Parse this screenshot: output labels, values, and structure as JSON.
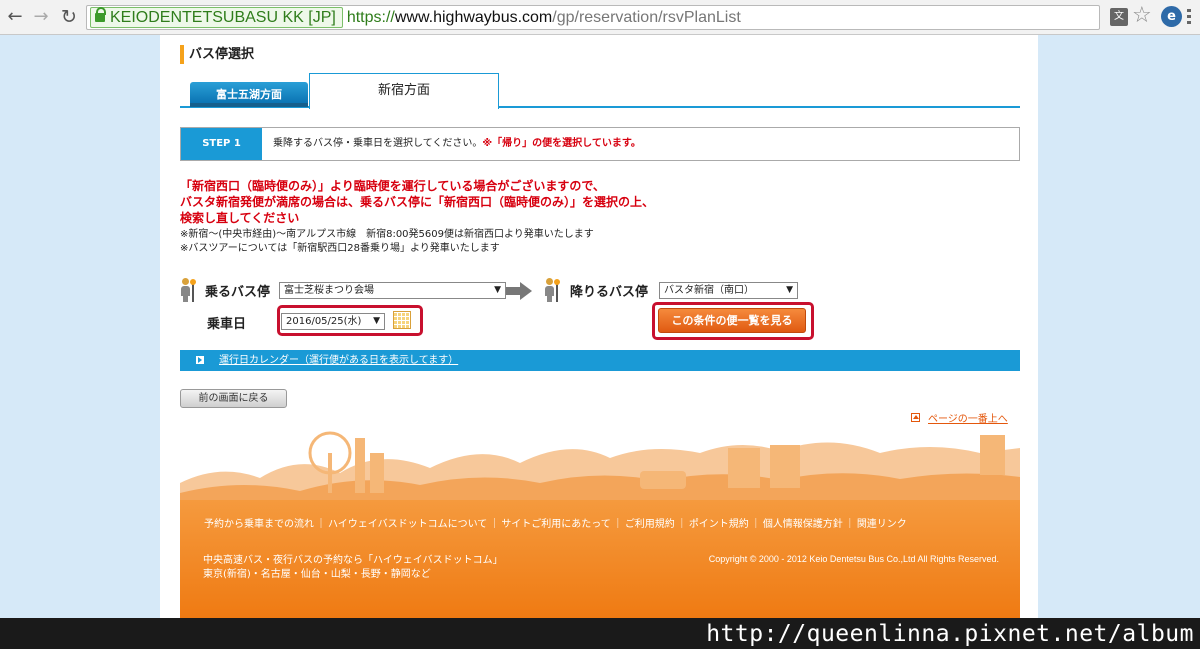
{
  "browser": {
    "cert_name": "KEIODENTETSUBASU KK [JP]",
    "url_scheme": "https://",
    "url_host": "www.highwaybus.com",
    "url_path": "/gp/reservation/rsvPlanList"
  },
  "page": {
    "section_title": "バス停選択",
    "tabs": [
      {
        "label": "富士五湖方面",
        "active": false
      },
      {
        "label": "新宿方面",
        "active": true
      }
    ],
    "step": {
      "label": "STEP 1",
      "text": "乗降するバス停・乗車日を選択してください。",
      "highlight": "※「帰り」の便を選択しています。"
    },
    "notice_lines": [
      "「新宿西口（臨時便のみ）」より臨時便を運行している場合がございますので、",
      "バスタ新宿発便が満席の場合は、乗るバス停に「新宿西口（臨時便のみ）」を選択の上、",
      "検索し直してください"
    ],
    "notes": [
      "※新宿～(中央市経由)～南アルプス市線　新宿8:00発5609便は新宿西口より発車いたします",
      "※バスツアーについては「新宿駅西口28番乗り場」より発車いたします"
    ],
    "form": {
      "ride_label": "乗るバス停",
      "ride_value": "富士芝桜まつり会場",
      "alight_label": "降りるバス停",
      "alight_value": "バスタ新宿（南口）",
      "date_label": "乗車日",
      "date_value": "2016/05/25(水)",
      "search_button": "この条件の便一覧を見る",
      "select_arrow": "▼"
    },
    "calendar_link": "運行日カレンダー（運行便がある日を表示してます）",
    "back_button": "前の画面に戻る",
    "page_top": "ページの一番上へ"
  },
  "footer": {
    "links": [
      "予約から乗車までの流れ",
      "ハイウェイバスドットコムについて",
      "サイトご利用にあたって",
      "ご利用規約",
      "ポイント規約",
      "個人情報保護方針",
      "関連リンク"
    ],
    "separator": "｜",
    "desc_lines": [
      "中央高速バス・夜行バスの予約なら「ハイウェイバスドットコム」",
      "東京(新宿)・名古屋・仙台・山梨・長野・静岡など"
    ],
    "copyright": "Copyright © 2000 - 2012 Keio Dentetsu Bus Co.,Ltd All Rights Reserved."
  },
  "watermark": "http://queenlinna.pixnet.net/album",
  "colors": {
    "accent_blue": "#1a9ad6",
    "accent_orange": "#ef7a12",
    "notice_red": "#d7000f",
    "highlight_red": "#c8102e"
  }
}
